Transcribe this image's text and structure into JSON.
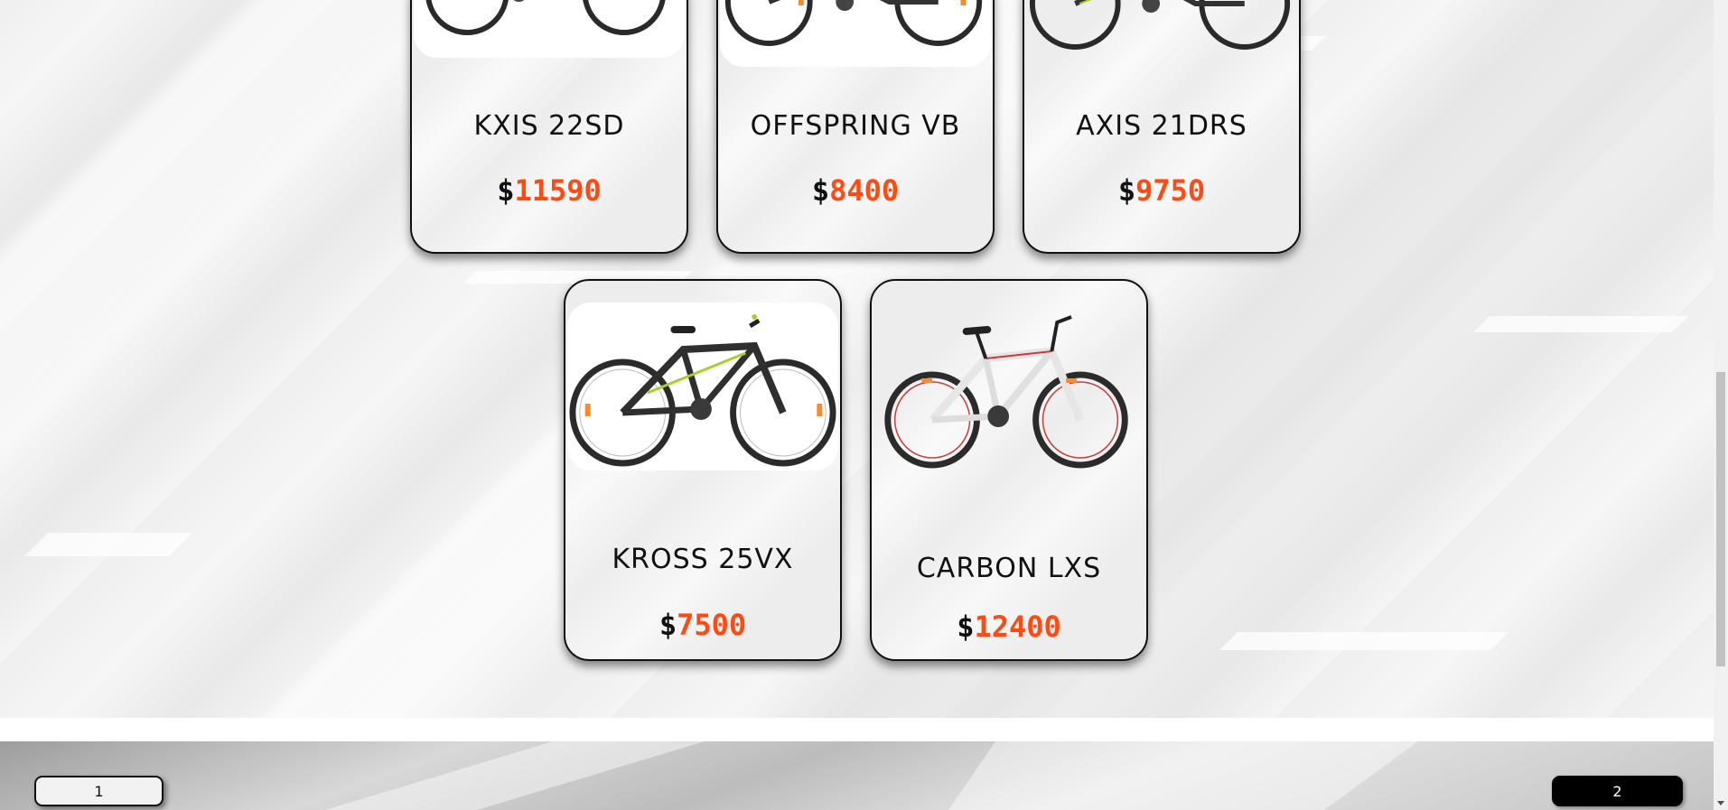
{
  "products": [
    {
      "name": "KXIS 22SD",
      "currency": "$",
      "price": "11590",
      "image": "mountain-bike-black-orange"
    },
    {
      "name": "OFFSPRING VB",
      "currency": "$",
      "price": "8400",
      "image": "mountain-bike-black-orange"
    },
    {
      "name": "AXIS 21DRS",
      "currency": "$",
      "price": "9750",
      "image": "mountain-bike-black-green"
    },
    {
      "name": "KROSS 25VX",
      "currency": "$",
      "price": "7500",
      "image": "mountain-bike-black-green"
    },
    {
      "name": "CARBON LXS",
      "currency": "$",
      "price": "12400",
      "image": "mountain-bike-white-red"
    }
  ],
  "pagination": {
    "pages": [
      "1",
      "2"
    ],
    "current": "2"
  },
  "colors": {
    "price_accent": "#ff4a12",
    "text": "#111111",
    "active_page_bg": "#000000"
  }
}
